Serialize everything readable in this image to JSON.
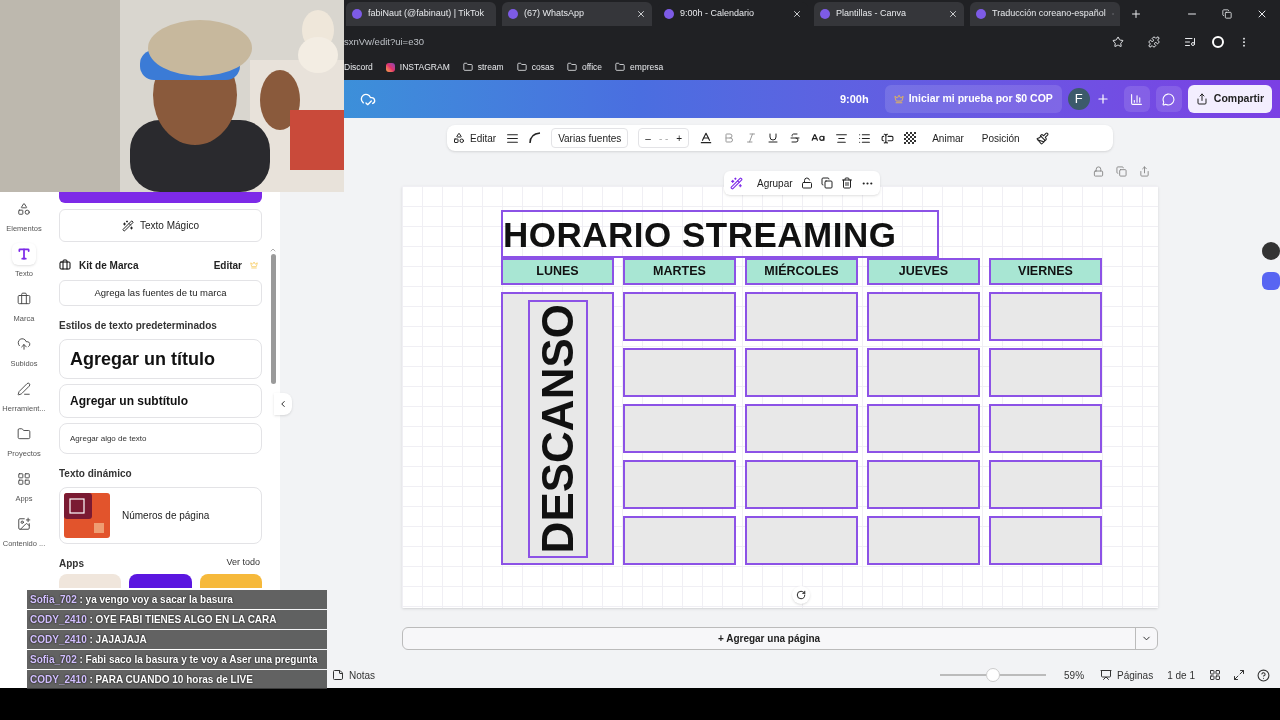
{
  "browser": {
    "tabs": [
      {
        "title": "fabiNaut (@fabinaut) | TikTok",
        "selected": false
      },
      {
        "title": "(67) WhatsApp",
        "selected": false
      },
      {
        "title": "9:00h - Calendario",
        "selected": true
      },
      {
        "title": "Plantillas - Canva",
        "selected": false
      },
      {
        "title": "Traducción coreano-español",
        "selected": false
      }
    ],
    "address": "sxnVw/edit?ui=e30",
    "bookmarks": [
      {
        "label": "Discord",
        "kind": "plain"
      },
      {
        "label": "INSTAGRAM",
        "kind": "instagram"
      },
      {
        "label": "stream",
        "kind": "folder"
      },
      {
        "label": "cosas",
        "kind": "folder"
      },
      {
        "label": "office",
        "kind": "folder"
      },
      {
        "label": "empresa",
        "kind": "folder"
      }
    ]
  },
  "header": {
    "time": "9:00h",
    "trial": "Iniciar mi prueba por $0 COP",
    "avatar": "F",
    "share": "Compartir"
  },
  "rail": [
    {
      "label": "Elementos",
      "selected": false
    },
    {
      "label": "Texto",
      "selected": true
    },
    {
      "label": "Marca",
      "selected": false
    },
    {
      "label": "Subidos",
      "selected": false
    },
    {
      "label": "Herramient...",
      "selected": false
    },
    {
      "label": "Proyectos",
      "selected": false
    },
    {
      "label": "Apps",
      "selected": false
    },
    {
      "label": "Contenido ...",
      "selected": false
    }
  ],
  "panel": {
    "magic": "Texto Mágico",
    "brand_kit": "Kit de Marca",
    "brand_edit": "Editar",
    "brand_fonts": "Agrega las fuentes de tu marca",
    "styles_heading": "Estilos de texto predeterminados",
    "title_style": "Agregar un título",
    "subtitle_style": "Agregar un subtítulo",
    "body_style": "Agregar algo de texto",
    "dynamic_heading": "Texto dinámico",
    "page_numbers": "Números de página",
    "apps_heading": "Apps",
    "see_all": "Ver todo",
    "apps": [
      {
        "color": "#f0e6dc"
      },
      {
        "color": "#5b16e0"
      },
      {
        "color": "#f6b93b"
      }
    ]
  },
  "toolbar": {
    "edit": "Editar",
    "font": "Varias fuentes",
    "size_minus": "–",
    "size": "- -",
    "size_plus": "+",
    "animate": "Animar",
    "position": "Posición"
  },
  "selection": {
    "group": "Agrupar"
  },
  "design": {
    "title": "HORARIO STREAMING",
    "days": [
      "LUNES",
      "MARTES",
      "MIÉRCOLES",
      "JUEVES",
      "VIERNES"
    ],
    "rest": "DESCANSO"
  },
  "add_page": "+ Agregar una página",
  "footer": {
    "notes": "Notas",
    "zoom": "59%",
    "zoom_slider": {
      "level": 0.5
    },
    "pages": "Páginas",
    "page_count": "1 de 1"
  },
  "chat": [
    {
      "user": "Sofia_702",
      "text": ": ya vengo voy a sacar la basura"
    },
    {
      "user": "CODY_2410",
      "text": ": OYE FABI TIENES ALGO EN LA CARA"
    },
    {
      "user": "CODY_2410",
      "text": ": JAJAJAJA"
    },
    {
      "user": "Sofia_702",
      "text": ": Fabi saco la basura y te voy a Aser una pregunta"
    },
    {
      "user": "CODY_2410",
      "text": ": PARA CUANDO 10 horas de LIVE"
    }
  ]
}
